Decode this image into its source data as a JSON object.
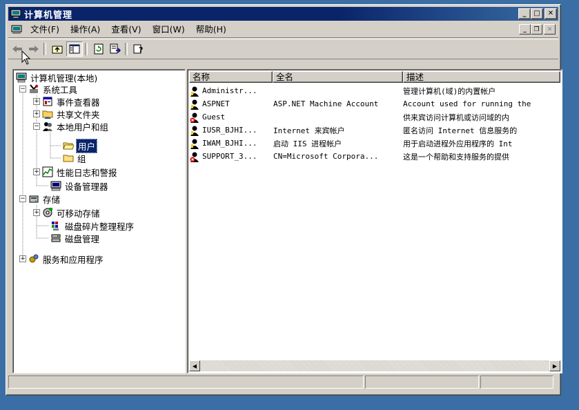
{
  "window": {
    "title": "计算机管理",
    "colors": {
      "titlebar": "#0a246a",
      "face": "#d4d0c8",
      "selection": "#0a246a",
      "desktop": "#3a6ea5"
    }
  },
  "menu": {
    "items": [
      "文件(F)",
      "操作(A)",
      "查看(V)",
      "窗口(W)",
      "帮助(H)"
    ]
  },
  "toolbar": {
    "buttons": [
      "back-icon",
      "forward-icon",
      "up-folder-icon",
      "show-tree-icon",
      "refresh-icon",
      "export-list-icon",
      "help-icon"
    ]
  },
  "tree": {
    "nodes": [
      {
        "label": "计算机管理(本地)",
        "icon": "computer-icon",
        "expander": ""
      },
      {
        "label": "系统工具",
        "icon": "tools-icon",
        "expander": "−"
      },
      {
        "label": "事件查看器",
        "icon": "event-viewer-icon",
        "expander": "+"
      },
      {
        "label": "共享文件夹",
        "icon": "shared-folder-icon",
        "expander": "+"
      },
      {
        "label": "本地用户和组",
        "icon": "users-groups-icon",
        "expander": "−"
      },
      {
        "label": "用户",
        "icon": "folder-open-icon",
        "expander": "",
        "selected": true
      },
      {
        "label": "组",
        "icon": "folder-icon",
        "expander": ""
      },
      {
        "label": "性能日志和警报",
        "icon": "performance-icon",
        "expander": "+"
      },
      {
        "label": "设备管理器",
        "icon": "device-manager-icon",
        "expander": ""
      },
      {
        "label": "存储",
        "icon": "storage-icon",
        "expander": "−"
      },
      {
        "label": "可移动存储",
        "icon": "removable-storage-icon",
        "expander": "+"
      },
      {
        "label": "磁盘碎片整理程序",
        "icon": "defrag-icon",
        "expander": ""
      },
      {
        "label": "磁盘管理",
        "icon": "disk-management-icon",
        "expander": ""
      },
      {
        "label": "服务和应用程序",
        "icon": "services-icon",
        "expander": "+"
      }
    ]
  },
  "list": {
    "columns": [
      "名称",
      "全名",
      "描述"
    ],
    "rows": [
      {
        "name": "Administr...",
        "fullname": "",
        "desc": "管理计算机(域)的内置帐户",
        "disabled": false
      },
      {
        "name": "ASPNET",
        "fullname": "ASP.NET Machine Account",
        "desc": "Account used for running the",
        "disabled": false
      },
      {
        "name": "Guest",
        "fullname": "",
        "desc": "供来宾访问计算机或访问域的内",
        "disabled": true
      },
      {
        "name": "IUSR_BJHI...",
        "fullname": "Internet 来宾帐户",
        "desc": "匿名访问 Internet 信息服务的",
        "disabled": false
      },
      {
        "name": "IWAM_BJHI...",
        "fullname": "启动 IIS 进程帐户",
        "desc": "用于启动进程外应用程序的 Int",
        "disabled": false
      },
      {
        "name": "SUPPORT_3...",
        "fullname": "CN=Microsoft Corpora...",
        "desc": "这是一个帮助和支持服务的提供",
        "disabled": true
      }
    ]
  },
  "status": {
    "panels": [
      "",
      "",
      ""
    ]
  }
}
